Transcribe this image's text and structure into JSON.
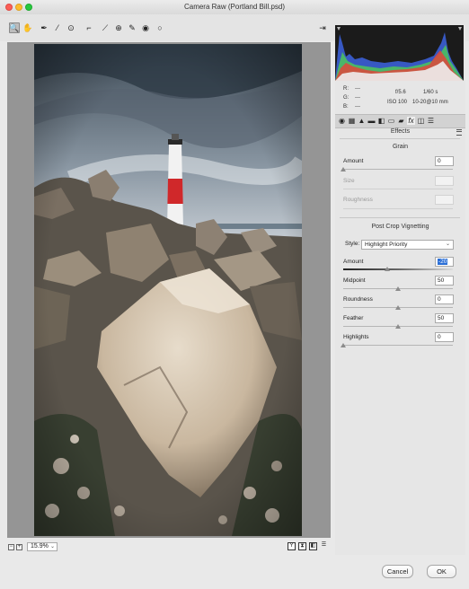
{
  "window": {
    "title": "Camera Raw (Portland Bill.psd)"
  },
  "toolbar": {
    "tools": [
      {
        "name": "zoom-tool",
        "glyph": "🔍"
      },
      {
        "name": "hand-tool",
        "glyph": "✋"
      },
      {
        "name": "white-balance-tool",
        "glyph": "✒"
      },
      {
        "name": "color-sampler-tool",
        "glyph": "⁄"
      },
      {
        "name": "targeted-adjustment-tool",
        "glyph": "⊙"
      },
      {
        "name": "crop-tool",
        "glyph": "⌐"
      },
      {
        "name": "straighten-tool",
        "glyph": "⟋"
      },
      {
        "name": "transform-tool",
        "glyph": "⊕"
      },
      {
        "name": "spot-removal-tool",
        "glyph": "✎"
      },
      {
        "name": "red-eye-tool",
        "glyph": "◉"
      },
      {
        "name": "adjustment-brush-tool",
        "glyph": "∕"
      },
      {
        "name": "graduated-filter-tool",
        "glyph": "▮"
      },
      {
        "name": "radial-filter-tool",
        "glyph": "○"
      }
    ],
    "open_preferences_glyph": "⇥"
  },
  "metadata": {
    "r_label": "R:",
    "r_value": "---",
    "g_label": "G:",
    "g_value": "---",
    "b_label": "B:",
    "b_value": "---",
    "aperture": "f/5.6",
    "shutter": "1/60 s",
    "iso": "ISO 100",
    "lens": "10-20@10 mm"
  },
  "panel_tabs": [
    "◉",
    "▦",
    "▲",
    "▬",
    "◧",
    "▭",
    "▰",
    "fx",
    "◫",
    "☰"
  ],
  "panel": {
    "title": "Effects",
    "grain": {
      "heading": "Grain",
      "amount_label": "Amount",
      "amount_value": "0",
      "amount_level": 0,
      "size_label": "Size",
      "size_value": "",
      "roughness_label": "Roughness",
      "roughness_value": ""
    },
    "vignetting": {
      "heading": "Post Crop Vignetting",
      "style_label": "Style:",
      "style_value": "Highlight Priority",
      "amount_label": "Amount",
      "amount_value": "-20",
      "amount_level": -20,
      "midpoint_label": "Midpoint",
      "midpoint_value": "50",
      "midpoint_level": 50,
      "roundness_label": "Roundness",
      "roundness_value": "0",
      "roundness_level": 0,
      "feather_label": "Feather",
      "feather_value": "50",
      "feather_level": 50,
      "highlights_label": "Highlights",
      "highlights_value": "0",
      "highlights_level": 0
    }
  },
  "bottom": {
    "zoom_minus": "−",
    "zoom_plus": "+",
    "zoom_value": "15.9%",
    "view_icons": [
      "Y",
      "⧗",
      "◧",
      "☰"
    ]
  },
  "buttons": {
    "cancel": "Cancel",
    "ok": "OK"
  },
  "colors": {
    "accent": "#2b6fd6",
    "lighthouse_red": "#d0282a"
  }
}
